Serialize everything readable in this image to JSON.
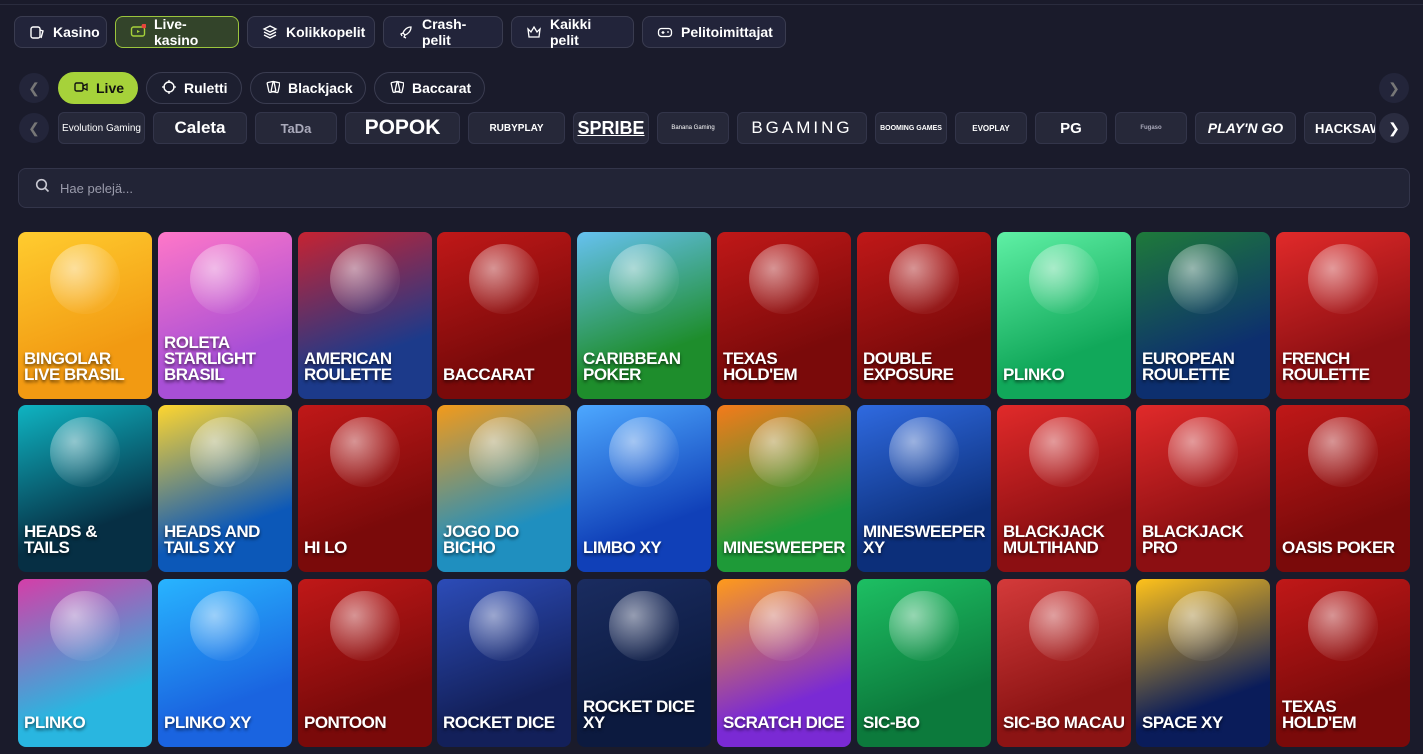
{
  "categories": [
    {
      "label": "Kasino",
      "icon": "casino-icon"
    },
    {
      "label": "Live-kasino",
      "icon": "live-tv-icon"
    },
    {
      "label": "Kolikkopelit",
      "icon": "layers-icon"
    },
    {
      "label": "Crash-pelit",
      "icon": "rocket-icon"
    },
    {
      "label": "Kaikki pelit",
      "icon": "crown-icon"
    },
    {
      "label": "Pelitoimittajat",
      "icon": "gamepad-icon"
    }
  ],
  "filters": [
    {
      "label": "Live",
      "icon": "video-icon"
    },
    {
      "label": "Ruletti",
      "icon": "roulette-icon"
    },
    {
      "label": "Blackjack",
      "icon": "cards-icon"
    },
    {
      "label": "Baccarat",
      "icon": "cards-icon"
    }
  ],
  "providers": [
    "Evolution Gaming",
    "Caleta",
    "TaDa",
    "POPOK",
    "RUBYPLAY",
    "SPRIBE",
    "Banana Gaming",
    "BGAMING",
    "BOOMING GAMES",
    "EVOPLAY",
    "PG",
    "Fugaso",
    "PLAY'N GO",
    "HACKSAW"
  ],
  "search": {
    "placeholder": "Hae pelejä..."
  },
  "games": [
    {
      "title": "BINGOLAR LIVE BRASIL",
      "bg": "#f29a12",
      "bg2": "#ffcc2f"
    },
    {
      "title": "ROLETA STARLIGHT BRASIL",
      "bg": "#a84fd6",
      "bg2": "#ff77c8"
    },
    {
      "title": "AMERICAN ROULETTE",
      "bg": "#1c3a8a",
      "bg2": "#c62332"
    },
    {
      "title": "BACCARAT",
      "bg": "#7a0a0a",
      "bg2": "#c01818"
    },
    {
      "title": "CARIBBEAN POKER",
      "bg": "#1e8d2c",
      "bg2": "#66c1f0"
    },
    {
      "title": "TEXAS HOLD'EM",
      "bg": "#7a0a0a",
      "bg2": "#c01818"
    },
    {
      "title": "DOUBLE EXPOSURE",
      "bg": "#7a0a0a",
      "bg2": "#c01818"
    },
    {
      "title": "PLINKO",
      "bg": "#11a85a",
      "bg2": "#5ff0a5"
    },
    {
      "title": "European Roulette",
      "bg": "#0d2f6e",
      "bg2": "#1e7a3a"
    },
    {
      "title": "FRENCH ROULETTE",
      "bg": "#8c0f12",
      "bg2": "#e12a2a"
    },
    {
      "title": "HEADS & TAILS",
      "bg": "#062f44",
      "bg2": "#0fb4c2"
    },
    {
      "title": "HEADS AND TAILS XY",
      "bg": "#0c58b8",
      "bg2": "#ffd62e"
    },
    {
      "title": "HI LO",
      "bg": "#7a0a0a",
      "bg2": "#c01818"
    },
    {
      "title": "JOGO DO BICHO",
      "bg": "#1f8fbf",
      "bg2": "#f39a1a"
    },
    {
      "title": "LIMBO XY",
      "bg": "#1040b8",
      "bg2": "#4da8ff"
    },
    {
      "title": "Minesweeper",
      "bg": "#1e9a38",
      "bg2": "#f57a1a"
    },
    {
      "title": "MINESWEEPER XY",
      "bg": "#0c2f7a",
      "bg2": "#2f6ae0"
    },
    {
      "title": "BLACKJACK MULTIHAND",
      "bg": "#8c0f12",
      "bg2": "#e12a2a"
    },
    {
      "title": "Blackjack Pro",
      "bg": "#8c0f12",
      "bg2": "#e12a2a"
    },
    {
      "title": "OASIS POKER",
      "bg": "#7a0a0a",
      "bg2": "#c01818"
    },
    {
      "title": "PLINKO",
      "bg": "#29b6e0",
      "bg2": "#d43ea8"
    },
    {
      "title": "PLINKO XY",
      "bg": "#1a64e0",
      "bg2": "#28b4ff"
    },
    {
      "title": "PONTOON",
      "bg": "#7a0a0a",
      "bg2": "#c01818"
    },
    {
      "title": "ROCKET DICE",
      "bg": "#13205a",
      "bg2": "#2c4cb8"
    },
    {
      "title": "ROCKET DICE XY",
      "bg": "#0c1a3f",
      "bg2": "#1a2c60"
    },
    {
      "title": "SCRATCH DICE",
      "bg": "#7a2ad4",
      "bg2": "#ff9a1a"
    },
    {
      "title": "SIC-BO",
      "bg": "#0c7a3c",
      "bg2": "#1dbf63"
    },
    {
      "title": "SIC-BO MACAU",
      "bg": "#8c1414",
      "bg2": "#d43a3a"
    },
    {
      "title": "SPACE XY",
      "bg": "#0a1c5a",
      "bg2": "#ffc21a"
    },
    {
      "title": "TEXAS HOLD'EM",
      "bg": "#7a0a0a",
      "bg2": "#c01818"
    }
  ]
}
